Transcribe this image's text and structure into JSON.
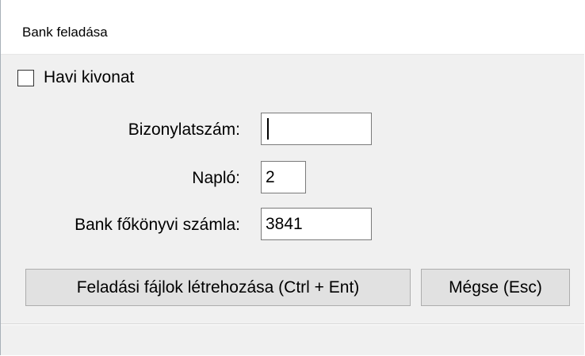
{
  "window": {
    "title": "Bank feladása"
  },
  "options": {
    "monthly_statement_label": "Havi kivonat",
    "monthly_statement_checked": false
  },
  "fields": {
    "document_number_label": "Bizonylatszám:",
    "document_number_value": "",
    "journal_label": "Napló:",
    "journal_value": "2",
    "bank_account_label": "Bank főkönyvi számla:",
    "bank_account_value": "3841"
  },
  "buttons": {
    "create_files_label": "Feladási fájlok létrehozása (Ctrl + Ent)",
    "cancel_label": "Mégse (Esc)"
  }
}
